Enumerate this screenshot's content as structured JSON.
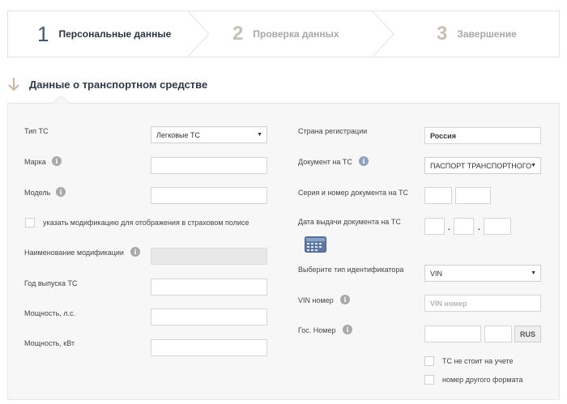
{
  "steps": [
    {
      "num": "1",
      "label": "Персональные данные"
    },
    {
      "num": "2",
      "label": "Проверка данных"
    },
    {
      "num": "3",
      "label": "Завершение"
    }
  ],
  "section": {
    "title": "Данные о транспортном средстве"
  },
  "left": {
    "vehicle_type_label": "Тип ТС",
    "vehicle_type_value": "Легковые ТС",
    "brand_label": "Марка",
    "model_label": "Модель",
    "modification_checkbox_label": "указать модификацию для отображения в страховом полисе",
    "modification_name_label": "Наименование модификации",
    "year_label": "Год выпуска ТС",
    "power_hp_label": "Мощность, л.с.",
    "power_kw_label": "Мощность, кВт"
  },
  "right": {
    "country_label": "Страна регистрации",
    "country_value": "Россия",
    "document_label": "Документ на ТС",
    "document_value": "ПАСПОРТ ТРАНСПОРТНОГО",
    "doc_series_label": "Серия и номер документа на ТС",
    "doc_date_label": "Дата выдачи документа на ТС",
    "id_type_label": "Выберите тип идентификатора",
    "id_type_value": "VIN",
    "vin_label": "VIN номер",
    "vin_placeholder": "VIN номер",
    "gos_label": "Гос. Номер",
    "rus_button": "RUS",
    "not_registered_label": "ТС не стоит на учете",
    "other_format_label": "номер другого формата"
  },
  "icons": {
    "info": "i",
    "select_caret": "▼",
    "date_separator": "."
  },
  "colors": {
    "active_step": "#3c5a78",
    "inactive_step": "#c7c0b7",
    "panel_bg": "#f7f7f7"
  }
}
